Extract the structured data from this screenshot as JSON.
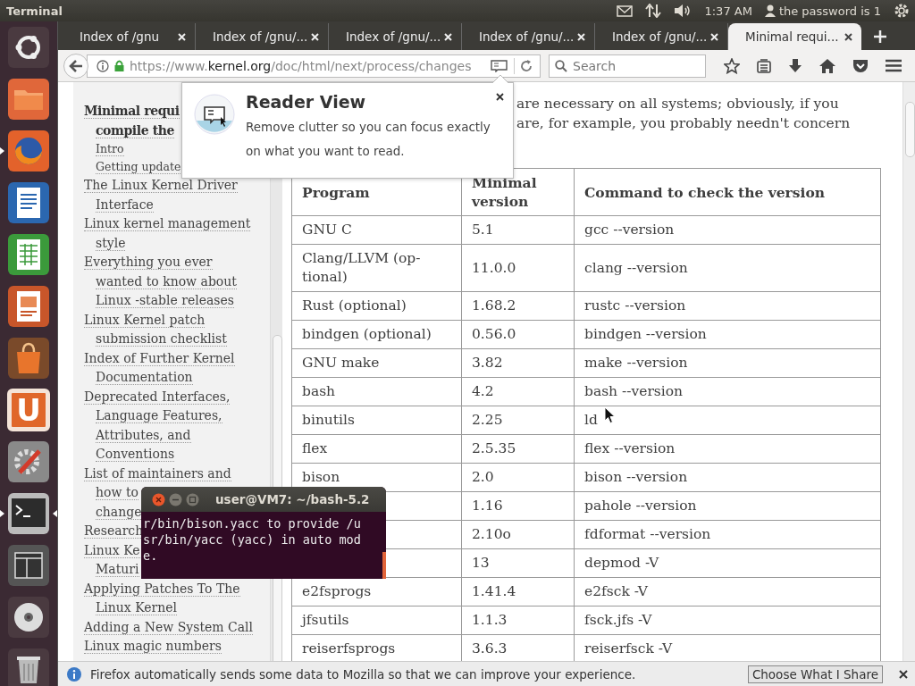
{
  "top_panel": {
    "app_title": "Terminal",
    "clock": "1:37 AM",
    "user": "the password is 1"
  },
  "launcher": [
    {
      "kind": "dash",
      "running": false,
      "focused": false
    },
    {
      "kind": "files",
      "running": false,
      "focused": false
    },
    {
      "kind": "browser",
      "running": true,
      "focused": false
    },
    {
      "kind": "writer",
      "running": false,
      "focused": false
    },
    {
      "kind": "calc",
      "running": false,
      "focused": false
    },
    {
      "kind": "impress",
      "running": false,
      "focused": false
    },
    {
      "kind": "store",
      "running": false,
      "focused": false
    },
    {
      "kind": "letter",
      "text": "U",
      "running": false,
      "focused": false
    },
    {
      "kind": "settings",
      "running": false,
      "focused": false
    },
    {
      "kind": "terminal",
      "running": true,
      "focused": true
    },
    {
      "kind": "workspaces",
      "running": false,
      "focused": false
    },
    {
      "kind": "disc",
      "running": false,
      "focused": false
    },
    {
      "kind": "trash",
      "running": false,
      "focused": false
    }
  ],
  "tabs": [
    {
      "label": "Index of /gnu",
      "selected": false
    },
    {
      "label": "Index of /gnu/...",
      "selected": false
    },
    {
      "label": "Index of /gnu/...",
      "selected": false
    },
    {
      "label": "Index of /gnu/...",
      "selected": false
    },
    {
      "label": "Index of /gnu/...",
      "selected": false
    },
    {
      "label": "Minimal requi...",
      "selected": true
    }
  ],
  "address_bar": {
    "url_start": "https://www.",
    "url_domain": "kernel.org",
    "url_path": "/doc/html/next/process/changes"
  },
  "search": {
    "placeholder": "Search"
  },
  "sidebar": {
    "items": [
      {
        "lines": [
          "Minimal requi",
          "compile the"
        ],
        "selected": true,
        "children": [
          {
            "lines": [
              "Intro"
            ],
            "selected": false
          },
          {
            "lines": [
              "Getting update"
            ],
            "selected": false
          }
        ]
      },
      {
        "lines": [
          "The Linux Kernel Driver",
          "Interface"
        ],
        "selected": false
      },
      {
        "lines": [
          "Linux kernel management",
          "style"
        ],
        "selected": false
      },
      {
        "lines": [
          "Everything you ever",
          "wanted to know about",
          "Linux -stable releases"
        ],
        "selected": false
      },
      {
        "lines": [
          "Linux Kernel patch",
          "submission checklist"
        ],
        "selected": false
      },
      {
        "lines": [
          "Index of Further Kernel",
          "Documentation"
        ],
        "selected": false
      },
      {
        "lines": [
          "Deprecated Interfaces,",
          "Language Features,",
          "Attributes, and",
          "Conventions"
        ],
        "selected": false
      },
      {
        "lines": [
          "List of maintainers and",
          "how to",
          "change"
        ],
        "selected": false
      },
      {
        "lines": [
          "Research"
        ],
        "selected": false
      },
      {
        "lines": [
          "Linux Ke",
          "Maturi"
        ],
        "selected": false
      },
      {
        "lines": [
          "Applying Patches To The",
          "Linux Kernel"
        ],
        "selected": false
      },
      {
        "lines": [
          "Adding a New System Call"
        ],
        "selected": false
      },
      {
        "lines": [
          "Linux magic numbers"
        ],
        "selected": false
      }
    ]
  },
  "paragraph_lines": [
    "are necessary on all systems; obviously, if you",
    "are, for example, you probably needn't concern"
  ],
  "table": {
    "columns": [
      "Program",
      "Minimal version",
      "Command to check the version"
    ],
    "rows": [
      {
        "program": "GNU C",
        "version": "5.1",
        "command": "gcc --version"
      },
      {
        "program": "Clang/LLVM (op-tional)",
        "version": "11.0.0",
        "command": "clang --version"
      },
      {
        "program": "Rust (optional)",
        "version": "1.68.2",
        "command": "rustc --version"
      },
      {
        "program": "bindgen (optional)",
        "version": "0.56.0",
        "command": "bindgen --version"
      },
      {
        "program": "GNU make",
        "version": "3.82",
        "command": "make --version"
      },
      {
        "program": "bash",
        "version": "4.2",
        "command": "bash --version"
      },
      {
        "program": "binutils",
        "version": "2.25",
        "command": "ld"
      },
      {
        "program": "flex",
        "version": "2.5.35",
        "command": "flex --version"
      },
      {
        "program": "bison",
        "version": "2.0",
        "command": "bison --version"
      },
      {
        "version": "1.16",
        "command": "pahole --version"
      },
      {
        "version": "2.10o",
        "command": "fdformat --version"
      },
      {
        "version": "13",
        "command": "depmod -V"
      },
      {
        "program": "e2fsprogs",
        "version": "1.41.4",
        "command": "e2fsck -V"
      },
      {
        "program": "jfsutils",
        "version": "1.1.3",
        "command": "fsck.jfs -V"
      },
      {
        "program": "reiserfsprogs",
        "version": "3.6.3",
        "command": "reiserfsck -V"
      }
    ]
  },
  "reader_popup": {
    "title": "Reader View",
    "text": "Remove clutter so you can focus exactly on what you want to read."
  },
  "terminal": {
    "title": "user@VM7: ~/bash-5.2",
    "lines": [
      "r/bin/bison.yacc to provide /u",
      "sr/bin/yacc (yacc) in auto mod",
      "e."
    ]
  },
  "notification": {
    "text": "Firefox automatically sends some data to Mozilla so that we can improve your experience.",
    "button": "Choose What I Share"
  }
}
